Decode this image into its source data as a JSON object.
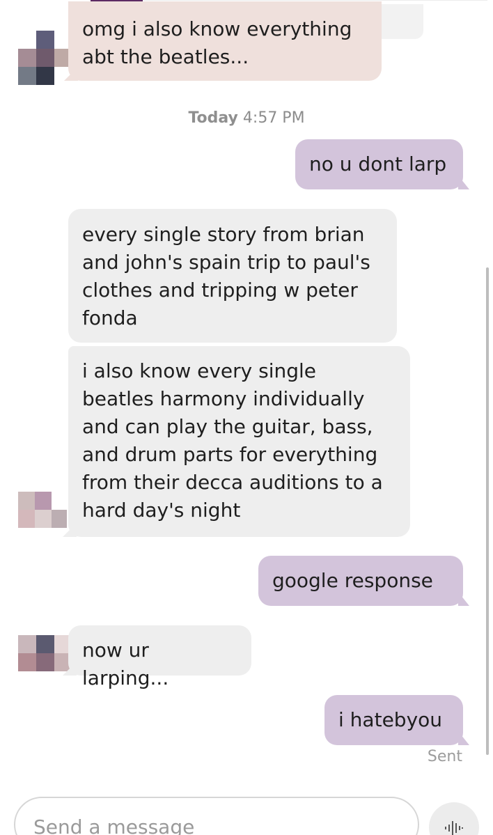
{
  "conversation": {
    "messages": [
      {
        "direction": "incoming",
        "text": "omg i also know everything\nabt the beatles..."
      },
      {
        "direction": "outgoing",
        "text": "no u dont larp"
      },
      {
        "direction": "incoming",
        "text": "every single story from brian\nand john's spain trip to paul's\nclothes and tripping w peter\nfonda"
      },
      {
        "direction": "incoming",
        "text": "i also know every single\nbeatles harmony individually\nand can play the guitar, bass,\nand drum parts for everything\nfrom their decca auditions to a\nhard day's night"
      },
      {
        "direction": "outgoing",
        "text": "google response"
      },
      {
        "direction": "incoming",
        "text": "now ur larping..."
      },
      {
        "direction": "outgoing",
        "text": "i hatebyou"
      }
    ],
    "timestamp": {
      "day": "Today",
      "time": "4:57 PM"
    },
    "status": "Sent"
  },
  "composer": {
    "placeholder": "Send a message",
    "voice_icon": "voice-waveform-icon"
  },
  "colors": {
    "incoming_bubble": "#eeeeee",
    "incoming_bubble_tinted": "#efe0dc",
    "outgoing_bubble": "#d3c4db",
    "accent": "#5c2a63"
  }
}
